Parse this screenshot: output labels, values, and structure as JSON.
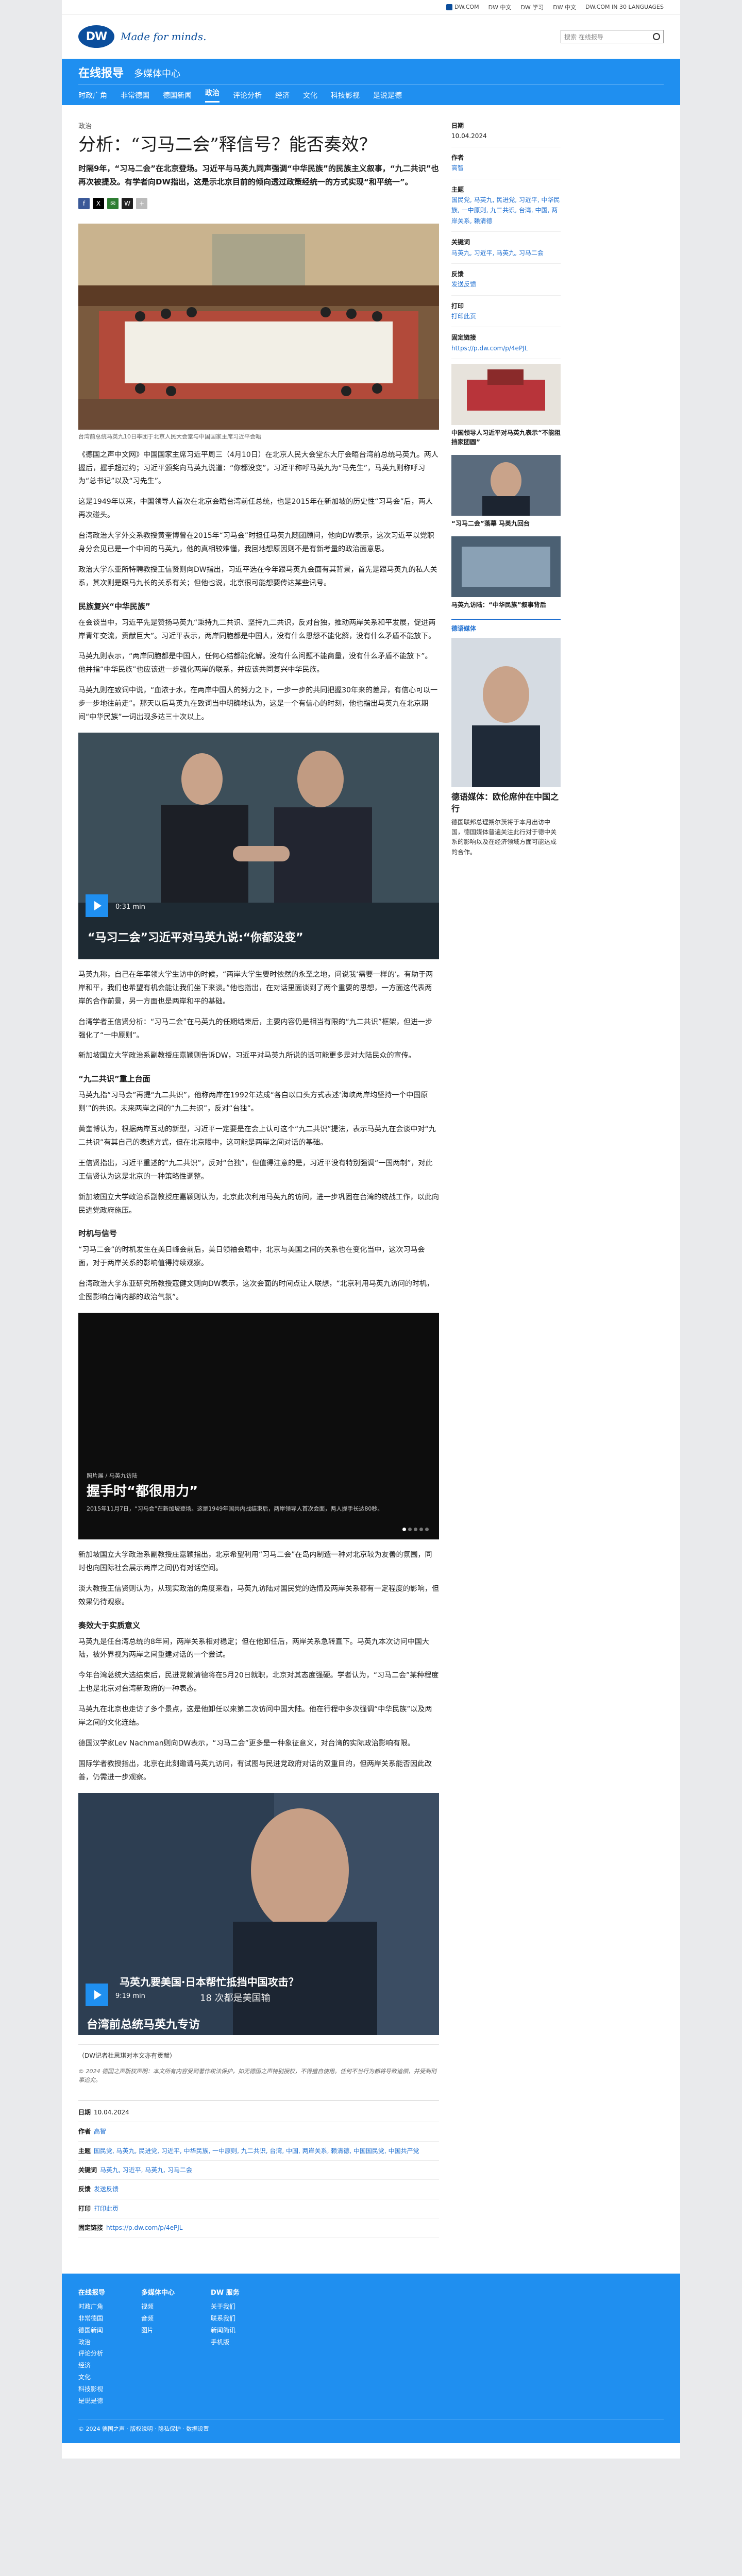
{
  "metabar": {
    "items": [
      "DW.COM",
      "DW 中文",
      "DW 学习",
      "DW 中文",
      "DW.COM IN 30 LANGUAGES"
    ]
  },
  "header": {
    "logo_text": "DW",
    "slogan": "Made for minds.",
    "search_placeholder": "搜索 在线报导"
  },
  "nav": {
    "section": "在线报导",
    "multimedia": "多媒体中心",
    "items": [
      "时政广角",
      "非常德国",
      "德国新闻",
      "政治",
      "评论分析",
      "经济",
      "文化",
      "科技影视",
      "是说是德"
    ],
    "active_index": 3
  },
  "article": {
    "kicker": "政治",
    "title": "分析：“习马二会”释信号？能否奏效？",
    "lead": "时隔9年，“习马二会”在北京登场。习近平与马英九同声强调“中华民族”的民族主义叙事，“九二共识”也再次被提及。有学者向DW指出，这是示北京目前的倾向透过政策经统一的方式实现“和平统一”。",
    "share": [
      "f",
      "X",
      "✉",
      "W",
      "+"
    ],
    "image_caption": "台湾前总统马英九10日率团于北京人民大会堂与中国国家主席习近平会晤",
    "paragraphs1": [
      "《德国之声中文网》中国国家主席习近平周三（4月10日）在北京人民大会堂东大厅会晤台湾前总统马英九。两人握后，握手超过约；习近平颁奖向马英九说道：“你都没变”，习近平称呼马英九为“马先生”，马英九则称呼习为“总书记”以及“习先生”。",
      "这是1949年以来，中国领导人首次在北京会晤台湾前任总统，也是2015年在新加坡的历史性“习马会”后，两人再次碰头。",
      "台湾政治大学外交系教授黄奎博曾在2015年“习马会”时担任马英九随团顾问，他向DW表示，这次习近平以党职身分会见已是一个中间的马英九，他的真相较难懂，我回地想原因则不是有新考量的政治面意思。",
      "政治大学东亚所特聘教授王信贤则向DW指出，习近平选在今年跟马英九会面有其背景，首先是跟马英九的私人关系，其次则是跟马九长的关系有关；但他也说，北京很可能想要传达某些讯号。"
    ],
    "sub1": "民族复兴“中华民族”",
    "paragraphs2": [
      "在会谈当中，习近平先是赞扬马英九“秉持九二共识、坚持九二共识，反对台独，推动两岸关系和平发展，促进两岸青年交流，贡献巨大”。习近平表示，两岸同胞都是中国人，没有什么恩怨不能化解，没有什么矛盾不能放下。",
      "马英九则表示，“两岸同胞都是中国人，任何心结都能化解。没有什么问题不能商量，没有什么矛盾不能放下”。他并指“中华民族”也应该进一步强化两岸的联系，并应该共同复兴中华民族。",
      "马英九则在致词中说，“血浓于水，在两岸中国人的努力之下，一步一步的共同把握30年来的差异，有信心可以一步一步地往前走”。那天以后马英九在致词当中明确地认为，这是一个有信心的时刻，他也指出马英九在北京期间“中华民族”一词出现多达三十次以上。"
    ],
    "video1": {
      "duration": "0:31 min",
      "title": "“马习二会”习近平对马英九说:“你都没变”"
    },
    "paragraphs3": [
      "马英九称，自己在年率领大学生访中的时候，“两岸大学生要时依然的永至之地，问说我‘需要一样的’。有助于两岸和平，我们也希望有机会能让我们坐下来谈。”他也指出，在对话里面谈到了两个重要的思想，一方面这代表两岸的合作前景，另一方面也是两岸和平的基础。",
      "台湾学者王信贤分析：“习马二会”在马英九的任期结束后，主要内容仍是相当有限的“九二共识”框架，但进一步强化了“一中原则”。",
      "新加坡国立大学政治系副教授庄嘉颖则告诉DW，习近平对马英九所说的话可能更多是对大陆民众的宣传。"
    ],
    "sub2": "“九二共识”重上台面",
    "paragraphs4": [
      "马英九指“习马会”再提“九二共识”，他称两岸在1992年达成“各自以口头方式表述‘海峡两岸均坚持一个中国原则’”的共识。未来两岸之间的“九二共识”，反对“台独”。",
      "黄奎博认为，根据两岸互动的新型，习近平一定要是在会上认可这个“九二共识”提法，表示马英九在会谈中对“九二共识”有其自己的表述方式，但在北京眼中，这可能是两岸之间对话的基础。",
      "王信贤指出，习近平重述的“九二共识”，反对“台独”，但值得注意的是，习近平没有特别强调“一国两制”，对此王信贤认为这是北京的一种策略性调整。",
      "新加坡国立大学政治系副教授庄嘉颖则认为，北京此次利用马英九的访问，进一步巩固在台湾的统战工作，以此向民进党政府施压。"
    ],
    "sub3": "时机与信号",
    "paragraphs5": [
      "“习马二会”的时机发生在美日峰会前后，美日领袖会晤中，北京与美国之间的关系也在变化当中，这次习马会面，对于两岸关系的影响值得持续观察。",
      "台湾政治大学东亚研究所教授寇健文则向DW表示，这次会面的时间点让人联想，“北京利用马英九访问的时机，企图影响台湾内部的政治气氛”。"
    ],
    "gallery": {
      "tag": "照片展 / 马英九访陆",
      "title": "握手时“都很用力”",
      "text": "2015年11月7日，“习马会”在新加坡登场。这是1949年国共内战结束后，两岸领导人首次会面，两人握手长达80秒。"
    },
    "paragraphs6": [
      "新加坡国立大学政治系副教授庄嘉颖指出，北京希望利用“习马二会”在岛内制造一种对北京较为友善的氛围，同时也向国际社会展示两岸之间仍有对话空间。",
      "淡大教授王信贤则认为，从现实政治的角度来看，马英九访陆对国民党的选情及两岸关系都有一定程度的影响，但效果仍待观察。"
    ],
    "sub4": "奏效大于实质意义",
    "paragraphs7": [
      "马英九是任台湾总统的8年间，两岸关系相对稳定；但在他卸任后，两岸关系急转直下。马英九本次访问中国大陆，被外界视为两岸之间重建对话的一个尝试。",
      "今年台湾总统大选结束后，民进党赖清德将在5月20日就职，北京对其态度强硬。学者认为，“习马二会”某种程度上也是北京对台湾新政府的一种表态。",
      "马英九在北京也走访了多个景点，这是他卸任以来第二次访问中国大陆。他在行程中多次强调“中华民族”以及两岸之间的文化连结。",
      "德国汉学家Lev Nachman则向DW表示，“习马二会”更多是一种象征意义，对台湾的实际政治影响有限。",
      "国际学者教授指出，北京在此刻邀请马英九访问，有试图与民进党政府对话的双重目的，但两岸关系能否因此改善，仍需进一步观察。"
    ],
    "video2": {
      "overlay": "马英九要美国·日本帮忙抵挡中国攻击？",
      "overlay2": "18 次都是美国输",
      "duration": "9:19 min",
      "title": "台湾前总统马英九专访"
    },
    "note": "（DW记者杜思琪对本文亦有贡献）",
    "copyright": "© 2024 德国之声版权声明：本文所有内容受到著作权法保护，如无德国之声特别授权，不得擅自使用。任何不当行为都将导致追偿，并受到刑事追究。"
  },
  "meta": {
    "date_label": "日期",
    "date": "10.04.2024",
    "author_label": "作者",
    "author": "高智",
    "topics_label": "主题",
    "topics": "国民党, 马英九, 民进党, 习近平, 中华民族, 一中原则, 九二共识, 台湾, 中国, 两岸关系, 赖清德, 中国国民党, 中国共产党",
    "keywords_label": "关键词",
    "keywords": "马英九, 习近平, 马英九, 习马二会",
    "feedback_label": "反馈",
    "feedback": "发送反馈",
    "print_label": "打印",
    "print": "打印此页",
    "permalink_label": "固定链接",
    "permalink": "https://p.dw.com/p/4ePJL"
  },
  "sidebar": {
    "date_label": "日期",
    "date": "10.04.2024",
    "author_label": "作者",
    "author": "高智",
    "topics_label": "主题",
    "topics": "国民党, 马英九, 民进党, 习近平, 中华民族, 一中原则, 九二共识, 台湾, 中国, 两岸关系, 赖清德",
    "keywords_label": "关键词",
    "keywords": "马英九, 习近平, 马英九, 习马二会",
    "feedback_label": "反馈",
    "feedback": "发送反馈",
    "print_label": "打印",
    "print": "打印此页",
    "permalink_label": "固定链接",
    "permalink": "https://p.dw.com/p/4ePJL",
    "related": [
      "中国领导人习近平对马英九表示“不能阻挡家团圆”",
      "“习马二会”落幕 马英九回台",
      "马英九访陆：“中华民族”叙事背后"
    ],
    "section_title": "德语媒体",
    "tall_title": "德语媒体：欧伦席仲在中国之行",
    "tall_text": "德国联邦总理朔尔茨将于本月出访中国，德国媒体普遍关注此行对于德中关系的影响以及在经济领域方面可能达成的合作。"
  },
  "footer": {
    "cols": [
      {
        "title": "在线报导",
        "items": [
          "时政广角",
          "非常德国",
          "德国新闻",
          "政治",
          "评论分析",
          "经济",
          "文化",
          "科技影视",
          "是说是德"
        ]
      },
      {
        "title": "多媒体中心",
        "items": [
          "视频",
          "音频",
          "图片"
        ]
      },
      {
        "title": "DW 服务",
        "items": [
          "关于我们",
          "联系我们",
          "新闻简讯",
          "手机版"
        ]
      }
    ],
    "bottom": "© 2024 德国之声 · 版权说明 · 隐私保护 · 数据设置"
  }
}
